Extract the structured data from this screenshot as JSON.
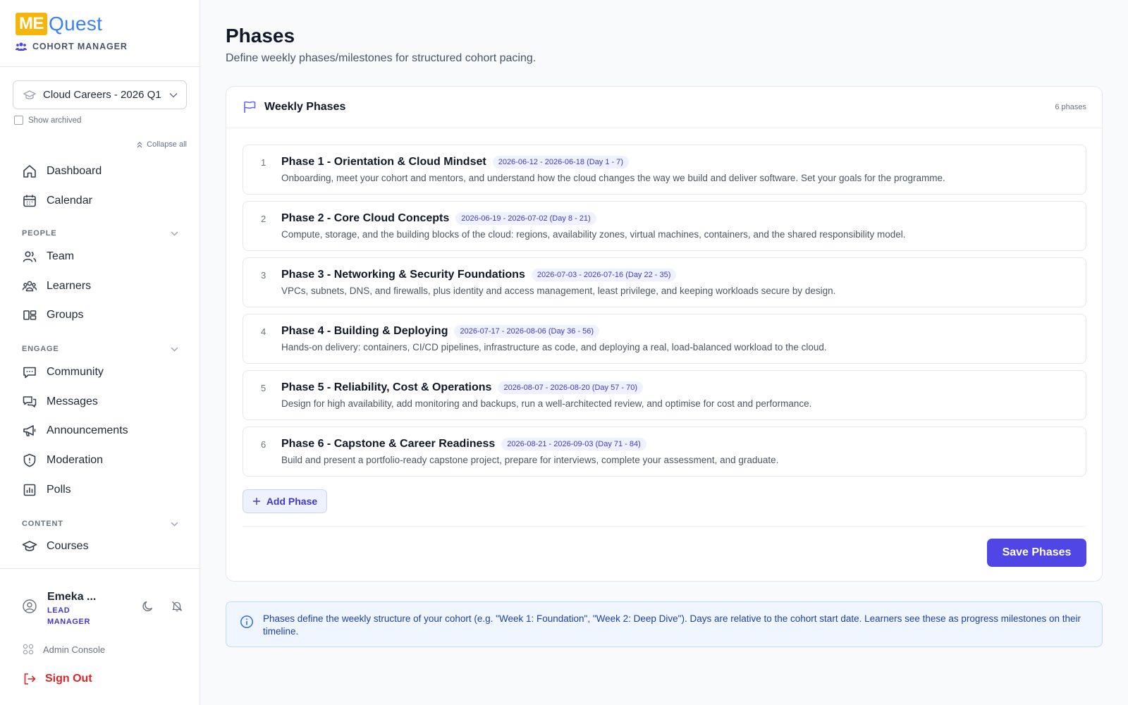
{
  "brand": {
    "logo_left": "ME",
    "logo_right": "Quest",
    "subtitle": "COHORT MANAGER"
  },
  "cohort_select": {
    "value": "Cloud Careers - 2026 Q1"
  },
  "show_archived_label": "Show archived",
  "collapse_all_label": "Collapse all",
  "nav": {
    "dashboard": "Dashboard",
    "calendar": "Calendar",
    "people_header": "PEOPLE",
    "team": "Team",
    "learners": "Learners",
    "groups": "Groups",
    "engage_header": "ENGAGE",
    "community": "Community",
    "messages": "Messages",
    "announcements": "Announcements",
    "moderation": "Moderation",
    "polls": "Polls",
    "content_header": "CONTENT",
    "courses": "Courses"
  },
  "user": {
    "name": "Emeka ...",
    "role_line1": "LEAD",
    "role_line2": "MANAGER"
  },
  "admin_console_label": "Admin Console",
  "sign_out_label": "Sign Out",
  "page": {
    "title": "Phases",
    "subtitle": "Define weekly phases/milestones for structured cohort pacing."
  },
  "card": {
    "title": "Weekly Phases",
    "count": "6 phases"
  },
  "phases": [
    {
      "num": "1",
      "name": "Phase 1 - Orientation & Cloud Mindset",
      "dates": "2026-06-12 - 2026-06-18 (Day 1 - 7)",
      "desc": "Onboarding, meet your cohort and mentors, and understand how the cloud changes the way we build and deliver software. Set your goals for the programme."
    },
    {
      "num": "2",
      "name": "Phase 2 - Core Cloud Concepts",
      "dates": "2026-06-19 - 2026-07-02 (Day 8 - 21)",
      "desc": "Compute, storage, and the building blocks of the cloud: regions, availability zones, virtual machines, containers, and the shared responsibility model."
    },
    {
      "num": "3",
      "name": "Phase 3 - Networking & Security Foundations",
      "dates": "2026-07-03 - 2026-07-16 (Day 22 - 35)",
      "desc": "VPCs, subnets, DNS, and firewalls, plus identity and access management, least privilege, and keeping workloads secure by design."
    },
    {
      "num": "4",
      "name": "Phase 4 - Building & Deploying",
      "dates": "2026-07-17 - 2026-08-06 (Day 36 - 56)",
      "desc": "Hands-on delivery: containers, CI/CD pipelines, infrastructure as code, and deploying a real, load-balanced workload to the cloud."
    },
    {
      "num": "5",
      "name": "Phase 5 - Reliability, Cost & Operations",
      "dates": "2026-08-07 - 2026-08-20 (Day 57 - 70)",
      "desc": "Design for high availability, add monitoring and backups, run a well-architected review, and optimise for cost and performance."
    },
    {
      "num": "6",
      "name": "Phase 6 - Capstone & Career Readiness",
      "dates": "2026-08-21 - 2026-09-03 (Day 71 - 84)",
      "desc": "Build and present a portfolio-ready capstone project, prepare for interviews, complete your assessment, and graduate."
    }
  ],
  "add_phase_label": "Add Phase",
  "save_label": "Save Phases",
  "info_text": "Phases define the weekly structure of your cohort (e.g. \"Week 1: Foundation\", \"Week 2: Deep Dive\"). Days are relative to the cohort start date. Learners see these as progress milestones on their timeline.",
  "colors": {
    "accent": "#4f46e5",
    "brand_yellow": "#f5b50a",
    "brand_blue": "#3b82f6",
    "danger": "#dc2626",
    "info_bg": "#eff6ff"
  }
}
